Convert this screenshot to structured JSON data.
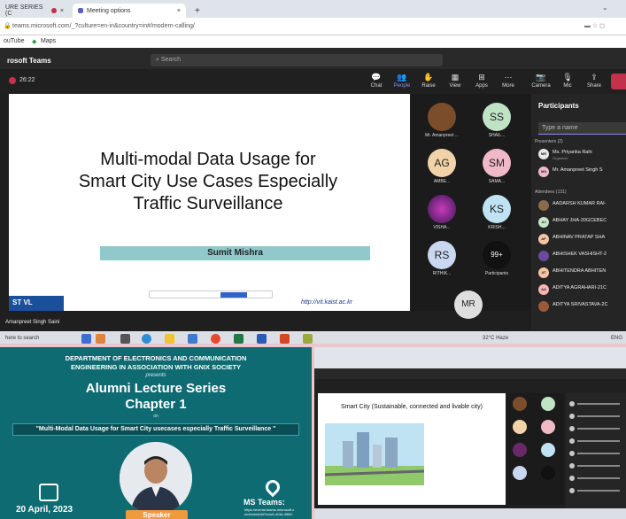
{
  "browser": {
    "tab1_label": "URE SERIES (C",
    "tab2_label": "Meeting options",
    "new_tab": "+",
    "url": "teams.microsoft.com/_?culture=en-in&country=in#/modern-calling/",
    "bookmark1": "ouTube",
    "bookmark2": "Maps"
  },
  "teams": {
    "app_title": "rosoft Teams",
    "search_placeholder": "Search",
    "timer": "26:22",
    "controls": [
      {
        "label": "Chat"
      },
      {
        "label": "People"
      },
      {
        "label": "Raise"
      },
      {
        "label": "View"
      },
      {
        "label": "Apps"
      },
      {
        "label": "More"
      },
      {
        "label": "Camera"
      },
      {
        "label": "Mic"
      },
      {
        "label": "Share"
      }
    ]
  },
  "slide": {
    "title_line1": "Multi-modal Data Usage for",
    "title_line2": "Smart City Use Cases Especially",
    "title_line3": "Traffic Surveillance",
    "presenter": "Sumit Mishra",
    "url": "http://vit.kaist.ac.kr",
    "logo": "ST VL"
  },
  "name_tag": "Amanpreet Singh Saini",
  "grid": {
    "tiles": [
      {
        "initials": "",
        "name": "Mr. Amanpreet ...",
        "color": "#7b4d2a"
      },
      {
        "initials": "SS",
        "name": "SHAIL...",
        "color": "#bfe3c4"
      },
      {
        "initials": "AG",
        "name": "AMBE...",
        "color": "#f2d3a9"
      },
      {
        "initials": "SM",
        "name": "SAMA...",
        "color": "#f1b8c8"
      },
      {
        "initials": "",
        "name": "VISHA...",
        "color": "#6a2a6a"
      },
      {
        "initials": "KS",
        "name": "KRISH...",
        "color": "#bfe3f2"
      },
      {
        "initials": "RS",
        "name": "RITHIK...",
        "color": "#c9d8f0"
      },
      {
        "initials": "99+",
        "name": "Participants",
        "color": "#111111"
      }
    ],
    "self_initials": "MR"
  },
  "participants": {
    "heading": "Participants",
    "search_placeholder": "Type a name",
    "presenters_label": "Presenters (2)",
    "attendees_label": "Attendees (131)",
    "presenters": [
      {
        "initials": "MR",
        "name": "Ms. Priyanka Rahi",
        "sub": "Organizer",
        "color": "#e8e8e8"
      },
      {
        "initials": "MS",
        "name": "Mr. Amanpreet Singh S",
        "sub": "",
        "color": "#f1b8c8"
      }
    ],
    "attendees": [
      {
        "initials": "",
        "name": "AADARSH KUMAR RAI-",
        "color": "#8a6a4a"
      },
      {
        "initials": "AJ",
        "name": "ABHAY JHA-20GCEBEC",
        "color": "#c8e6c9"
      },
      {
        "initials": "AP",
        "name": "ABHINAV PRATAP SHA",
        "color": "#f5c6a5"
      },
      {
        "initials": "",
        "name": "ABHISHEK VASHISHT-2",
        "color": "#6a4aa0"
      },
      {
        "initials": "AT",
        "name": "ABHITENDRA ABHITEN",
        "color": "#f5c6a5"
      },
      {
        "initials": "AA",
        "name": "ADITYA AGRAHARI-21C",
        "color": "#f8b4b4"
      },
      {
        "initials": "",
        "name": "ADITYA SRIVASTAVA-2C",
        "color": "#9a5a3a"
      }
    ]
  },
  "taskbar": {
    "search": "here to search",
    "weather": "32°C  Haze",
    "tray": "ENG"
  },
  "poster": {
    "dept": "DEPARTMENT OF ELECTRONICS AND COMMUNICATION",
    "dept2": "ENGINEERING IN ASSOCIATION WITH GNIX SOCIETY",
    "presents": "presents",
    "series": "Alumni Lecture Series",
    "chapter": "Chapter 1",
    "on": "on",
    "topic": "\"Multi-Modal Data Usage for Smart City usecases especially Traffic Surveillance \"",
    "date": "20 April, 2023",
    "speaker": "Speaker",
    "ms_teams": "MS Teams:",
    "ms_link": "https://events.teams.microsoft.c om/event/d47edu0-d13d-4969-"
  },
  "mini": {
    "slide_title": "Smart City (Sustainable, connected and livable city)"
  }
}
